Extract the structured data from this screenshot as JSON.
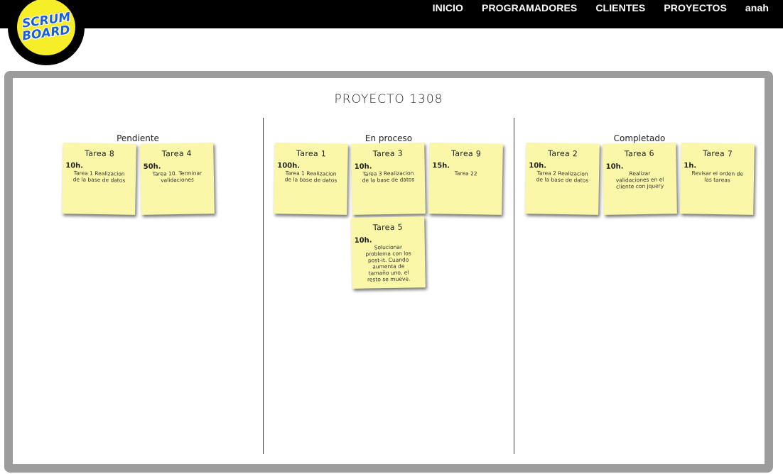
{
  "logo": {
    "line1": "SCRUM",
    "line2": "BOARD"
  },
  "nav": {
    "inicio": "INICIO",
    "programadores": "PROGRAMADORES",
    "clientes": "CLIENTES",
    "proyectos": "PROYECTOS",
    "user": "anah"
  },
  "board": {
    "title": "PROYECTO 1308",
    "columns": [
      {
        "title": "Pendiente"
      },
      {
        "title": "En proceso"
      },
      {
        "title": "Completado"
      }
    ],
    "tasks": {
      "t8": {
        "title": "Tarea 8",
        "hours": "10h.",
        "desc": "Tarea 1 Realizacion de la base de datos"
      },
      "t4": {
        "title": "Tarea 4",
        "hours": "50h.",
        "desc": "Tarea 10. Terminar validaciones"
      },
      "t1": {
        "title": "Tarea 1",
        "hours": "100h.",
        "desc": "Tarea 1 Realizacion de la base de datos"
      },
      "t3": {
        "title": "Tarea 3",
        "hours": "10h.",
        "desc": "Tarea 3 Realizacion de la base de datos"
      },
      "t9": {
        "title": "Tarea 9",
        "hours": "15h.",
        "desc": "Tarea 22"
      },
      "t5": {
        "title": "Tarea 5",
        "hours": "10h.",
        "desc": "Solucionar problema con los post-it. Cuando aumenta de tamaño uno, el resto se mueve."
      },
      "t2": {
        "title": "Tarea 2",
        "hours": "10h.",
        "desc": "Tarea 2 Realizacion de la base de datos"
      },
      "t6": {
        "title": "Tarea 6",
        "hours": "10h.",
        "desc": "Realizar validaciones en el cliente con jquery"
      },
      "t7": {
        "title": "Tarea 7",
        "hours": "1h.",
        "desc": "Revisar el orden de las tareas"
      }
    }
  }
}
